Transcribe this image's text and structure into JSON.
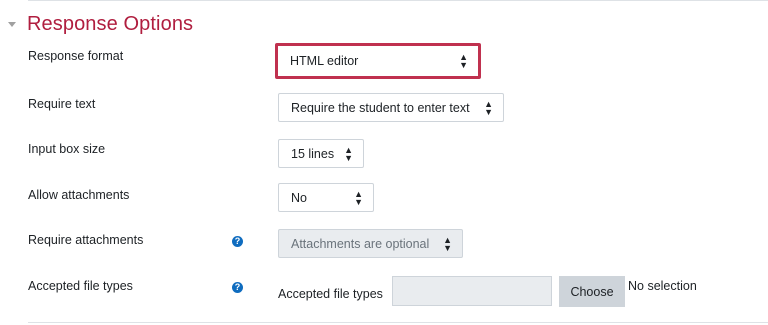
{
  "section": {
    "title": "Response Options"
  },
  "fields": {
    "response_format": {
      "label": "Response format",
      "value": "HTML editor"
    },
    "require_text": {
      "label": "Require text",
      "value": "Require the student to enter text"
    },
    "input_box_size": {
      "label": "Input box size",
      "value": "15 lines"
    },
    "allow_attachments": {
      "label": "Allow attachments",
      "value": "No"
    },
    "require_attachments": {
      "label": "Require attachments",
      "value": "Attachments are optional",
      "disabled": true
    },
    "accepted_file_types": {
      "label": "Accepted file types",
      "inner_label": "Accepted file types",
      "button": "Choose",
      "status": "No selection"
    }
  },
  "icons": {
    "section_toggle": "caret-down-icon",
    "help": "question-circle-icon",
    "select_arrows": "up-down-arrows-icon"
  },
  "colors": {
    "title": "#b01e3f",
    "highlight_border": "#c0314f",
    "help_icon": "#0f6cbf"
  }
}
